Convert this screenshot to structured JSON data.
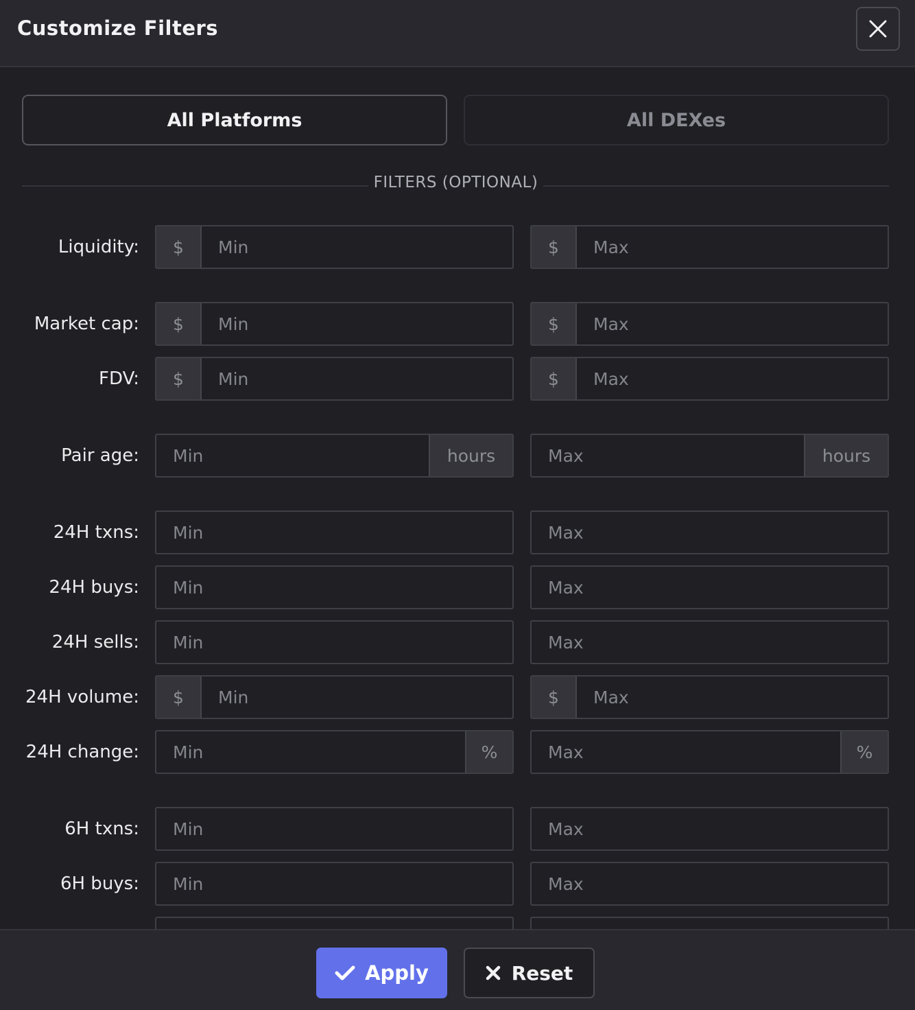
{
  "header": {
    "title": "Customize Filters",
    "close_icon": "close-icon"
  },
  "tabs": {
    "platforms_label": "All Platforms",
    "dexes_label": "All DEXes"
  },
  "section": {
    "label": "FILTERS (OPTIONAL)"
  },
  "currency_symbol": "$",
  "hours_unit": "hours",
  "percent_unit": "%",
  "placeholders": {
    "min": "Min",
    "max": "Max"
  },
  "rows": [
    {
      "label": "Liquidity:"
    },
    {
      "label": "Market cap:"
    },
    {
      "label": "FDV:"
    },
    {
      "label": "Pair age:"
    },
    {
      "label": "24H txns:"
    },
    {
      "label": "24H buys:"
    },
    {
      "label": "24H sells:"
    },
    {
      "label": "24H volume:"
    },
    {
      "label": "24H change:"
    },
    {
      "label": "6H txns:"
    },
    {
      "label": "6H buys:"
    }
  ],
  "footer": {
    "apply_label": "Apply",
    "reset_label": "Reset",
    "apply_icon": "check-icon",
    "reset_icon": "x-icon"
  },
  "colors": {
    "accent": "#6271ea",
    "background": "#1f1f24",
    "panel": "#28282e"
  }
}
